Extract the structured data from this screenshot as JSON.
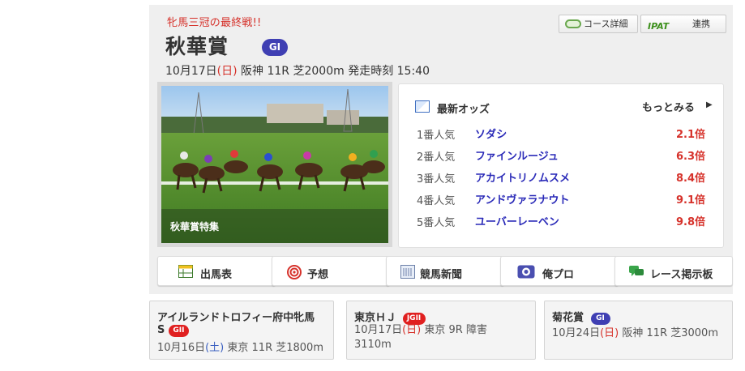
{
  "header": {
    "kicker": "牝馬三冠の最終戦!!",
    "title": "秋華賞",
    "grade": "GI",
    "date": "10月17日",
    "dow": "(日)",
    "details": "阪神 11R 芝2000m 発走時刻 15:40"
  },
  "top_buttons": {
    "course": "コース詳細",
    "ipat_logo": "IPAT",
    "ipat": "連携"
  },
  "feature": {
    "caption": "秋華賞特集"
  },
  "odds": {
    "title": "最新オッズ",
    "more": "もっとみる",
    "rows": [
      {
        "rank": "1番人気",
        "horse": "ソダシ",
        "odds": "2.1倍"
      },
      {
        "rank": "2番人気",
        "horse": "ファインルージュ",
        "odds": "6.3倍"
      },
      {
        "rank": "3番人気",
        "horse": "アカイトリノムスメ",
        "odds": "8.4倍"
      },
      {
        "rank": "4番人気",
        "horse": "アンドヴァラナウト",
        "odds": "9.1倍"
      },
      {
        "rank": "5番人気",
        "horse": "ユーバーレーベン",
        "odds": "9.8倍"
      }
    ]
  },
  "nav": {
    "entries": "出馬表",
    "predict": "予想",
    "newspaper": "競馬新聞",
    "blog": "俺プロ",
    "board": "レース掲示板"
  },
  "related": [
    {
      "name_1": "アイルランドトロフィー府中牝馬",
      "name_2": "S",
      "grade": "GII",
      "date": "10月16日",
      "dow": "(土)",
      "info": "東京 11R 芝1800m"
    },
    {
      "name": "東京ＨＪ",
      "grade": "JGII",
      "date": "10月17日",
      "dow": "(日)",
      "info": "東京 9R 障害",
      "info2": "3110m"
    },
    {
      "name": "菊花賞",
      "grade": "GI",
      "date": "10月24日",
      "dow": "(日)",
      "info": "阪神 11R 芝3000m"
    }
  ],
  "colors": {
    "accent_red": "#d6322b",
    "grade_g1": "#3f3fb3",
    "grade_g2": "#e02020",
    "horse_link": "#2a2ab8"
  }
}
